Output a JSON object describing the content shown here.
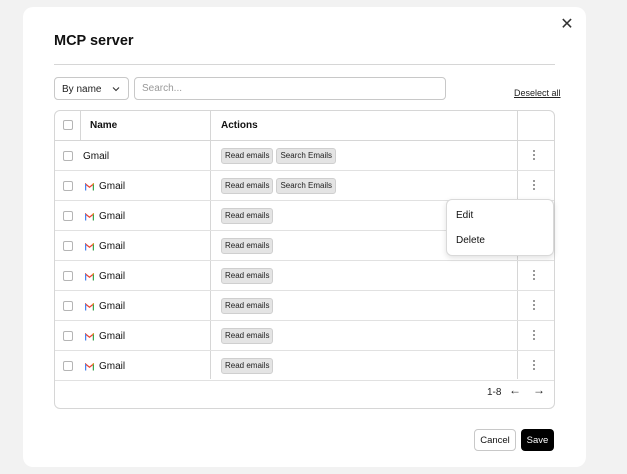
{
  "modal": {
    "title": "MCP server",
    "close_icon": "close-icon"
  },
  "toolbar": {
    "sort_value": "By name",
    "search_placeholder": "Search...",
    "deselect_label": "Deselect all"
  },
  "table": {
    "columns": [
      "Name",
      "Actions"
    ],
    "rows": [
      {
        "name": "Gmail",
        "icon": false,
        "actions": [
          "Read emails",
          "Search Emails"
        ]
      },
      {
        "name": "Gmail",
        "icon": true,
        "actions": [
          "Read emails",
          "Search Emails"
        ]
      },
      {
        "name": "Gmail",
        "icon": true,
        "actions": [
          "Read emails"
        ]
      },
      {
        "name": "Gmail",
        "icon": true,
        "actions": [
          "Read emails"
        ]
      },
      {
        "name": "Gmail",
        "icon": true,
        "actions": [
          "Read emails"
        ]
      },
      {
        "name": "Gmail",
        "icon": true,
        "actions": [
          "Read emails"
        ]
      },
      {
        "name": "Gmail",
        "icon": true,
        "actions": [
          "Read emails"
        ]
      },
      {
        "name": "Gmail",
        "icon": true,
        "actions": [
          "Read emails"
        ]
      }
    ],
    "pagination": {
      "range": "1-8",
      "prev": "←",
      "next": "→"
    }
  },
  "context_menu": {
    "items": [
      "Edit",
      "Delete"
    ]
  },
  "footer": {
    "cancel_label": "Cancel",
    "save_label": "Save"
  },
  "colors": {
    "gmail_red": "#ea4335",
    "gmail_blue": "#4285f4",
    "gmail_green": "#34a853",
    "gmail_yellow": "#fbbc04"
  }
}
